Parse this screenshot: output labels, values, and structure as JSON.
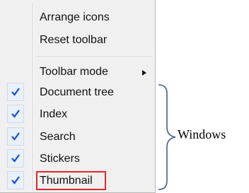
{
  "menu": {
    "items": [
      {
        "label": "Arrange icons",
        "checked": false
      },
      {
        "label": "Reset toolbar",
        "checked": false
      },
      {
        "label": "Toolbar mode",
        "checked": false,
        "submenu": true
      },
      {
        "label": "Document tree",
        "checked": true
      },
      {
        "label": "Index",
        "checked": true
      },
      {
        "label": "Search",
        "checked": true
      },
      {
        "label": "Stickers",
        "checked": true
      },
      {
        "label": "Thumbnail",
        "checked": true,
        "highlighted": true
      }
    ]
  },
  "annotation": {
    "label": "Windows"
  },
  "colors": {
    "check": "#1a4fc4",
    "highlight_border": "#e0282d",
    "brace": "#3f5e8f"
  }
}
